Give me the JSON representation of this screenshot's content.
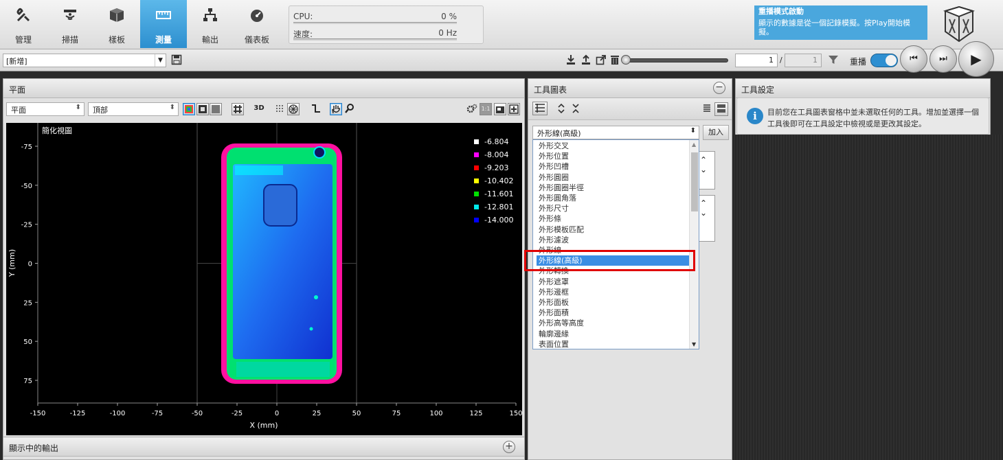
{
  "nav": {
    "items": [
      {
        "label": "管理",
        "icon": "tools-icon"
      },
      {
        "label": "掃描",
        "icon": "scan-icon"
      },
      {
        "label": "樣板",
        "icon": "cubes-icon"
      },
      {
        "label": "測量",
        "icon": "ruler-icon",
        "active": true
      },
      {
        "label": "輸出",
        "icon": "network-icon"
      },
      {
        "label": "儀表板",
        "icon": "gauge-icon"
      }
    ]
  },
  "stats": {
    "cpu_label": "CPU:",
    "cpu_value": "0 %",
    "speed_label": "速度:",
    "speed_value": "0 Hz"
  },
  "notice": {
    "title": "重播模式啟動",
    "body": "顯示的數據是從一個記錄模擬。按Play開始模擬。"
  },
  "job": {
    "selected": "[新增]"
  },
  "playback": {
    "page_current": "1",
    "page_sep": "/",
    "page_total": "1",
    "replay_label": "重播"
  },
  "plane_panel": {
    "title": "平面",
    "view_select": "平面",
    "side_select": "頂部",
    "mode_3d": "3D",
    "viewport_title": "簡化視圖",
    "hint_badge": "1:1"
  },
  "tool_panel": {
    "title": "工具圖表",
    "selected_tool": "外形線(高級)",
    "add_label": "加入"
  },
  "dropdown": {
    "items": [
      "外形交叉",
      "外形位置",
      "外形凹槽",
      "外形圓圈",
      "外形圓圈半徑",
      "外形圓角落",
      "外形尺寸",
      "外形條",
      "外形模板匹配",
      "外形濾波",
      "外形線",
      "外形線(高級)",
      "外形轉換",
      "外形遮罩",
      "外形邊框",
      "外形面板",
      "外形面積",
      "外形高等高度",
      "輪廓邊緣",
      "表面位置"
    ],
    "selected_index": 11
  },
  "settings_panel": {
    "title": "工具設定",
    "info_text": "目前您在工具圖表窗格中並未選取任何的工具。增加並選擇一個工具後即可在工具設定中檢視或是更改其設定。"
  },
  "output_panel": {
    "title": "顯示中的輸出"
  },
  "chart_data": {
    "type": "heatmap",
    "title": "簡化視圖",
    "xlabel": "X (mm)",
    "ylabel": "Y (mm)",
    "xlim": [
      -150,
      150
    ],
    "ylim": [
      -75,
      75
    ],
    "x_ticks": [
      -150,
      -125,
      -100,
      -75,
      -50,
      -25,
      0,
      25,
      50,
      75,
      100,
      125,
      150
    ],
    "y_ticks": [
      -75,
      -50,
      -25,
      0,
      25,
      50,
      75
    ],
    "legend": [
      {
        "value": "-6.804",
        "color": "#ffffff"
      },
      {
        "value": "-8.004",
        "color": "#ff00ff"
      },
      {
        "value": "-9.203",
        "color": "#ff0000"
      },
      {
        "value": "-10.402",
        "color": "#ffff00"
      },
      {
        "value": "-11.601",
        "color": "#00e000"
      },
      {
        "value": "-12.801",
        "color": "#00e8e8"
      },
      {
        "value": "-14.000",
        "color": "#0000ff"
      }
    ],
    "legend_placement": "top-right"
  }
}
